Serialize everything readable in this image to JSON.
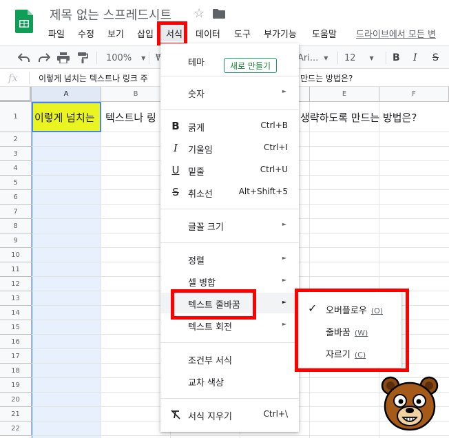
{
  "app": {
    "title": "제목 없는 스프레드시트",
    "brand_color": "#0f9d58"
  },
  "menubar": {
    "items": [
      "파일",
      "수정",
      "보기",
      "삽입",
      "서식",
      "데이터",
      "도구",
      "부가기능",
      "도움말"
    ],
    "active": "서식",
    "drive_link": "드라이브에서 모든 변"
  },
  "toolbar": {
    "zoom": "100%",
    "currency": "₩",
    "font": "Ari...",
    "font_size": "12",
    "bold": "B",
    "italic": "I",
    "strike": "S"
  },
  "formula_bar": {
    "fx": "fx",
    "content": "이렇게 넘치는 텍스트나 링크 주",
    "content_tail": "만드는 방법은?"
  },
  "sheet": {
    "columns": [
      "A",
      "B",
      "C",
      "D",
      "E",
      "F"
    ],
    "rows": [
      "1",
      "2",
      "3",
      "4",
      "5",
      "6",
      "7",
      "8",
      "9",
      "10",
      "11",
      "12",
      "13",
      "14",
      "15",
      "16",
      "17",
      "18",
      "19",
      "20",
      "21",
      "22"
    ],
    "cell_a1": "이렇게 넘치는 텍스트나 링크 주소를 생략하도록 만드는 방법은?",
    "cell_a1_left": "이렇게 넘치는",
    "cell_a1_mid": "텍스트나 링",
    "cell_a1_right": "생략하도록 만드는 방법은?",
    "selected_color": "#eaf420"
  },
  "format_menu": {
    "theme": "테마",
    "new_button": "새로 만들기",
    "number": "숫자",
    "bold": "굵게",
    "bold_shortcut": "Ctrl+B",
    "italic": "기울임",
    "italic_shortcut": "Ctrl+I",
    "underline": "밑줄",
    "underline_shortcut": "Ctrl+U",
    "strikethrough": "취소선",
    "strikethrough_shortcut": "Alt+Shift+5",
    "font_size": "글꼴 크기",
    "align": "정렬",
    "merge": "셀 병합",
    "wrap": "텍스트 줄바꿈",
    "rotate": "텍스트 회전",
    "conditional": "조건부 서식",
    "alternating": "교차 색상",
    "clear": "서식 지우기",
    "clear_shortcut": "Ctrl+\\",
    "icons": {
      "bold": "B",
      "italic": "I",
      "underline": "U",
      "strikethrough": "S"
    }
  },
  "wrap_submenu": {
    "items": [
      {
        "label": "오버플로우",
        "key": "(O)",
        "checked": true
      },
      {
        "label": "줄바꿈",
        "key": "(W)",
        "checked": false
      },
      {
        "label": "자르기",
        "key": "(C)",
        "checked": false
      }
    ]
  },
  "annotation_color": "#ff0000"
}
